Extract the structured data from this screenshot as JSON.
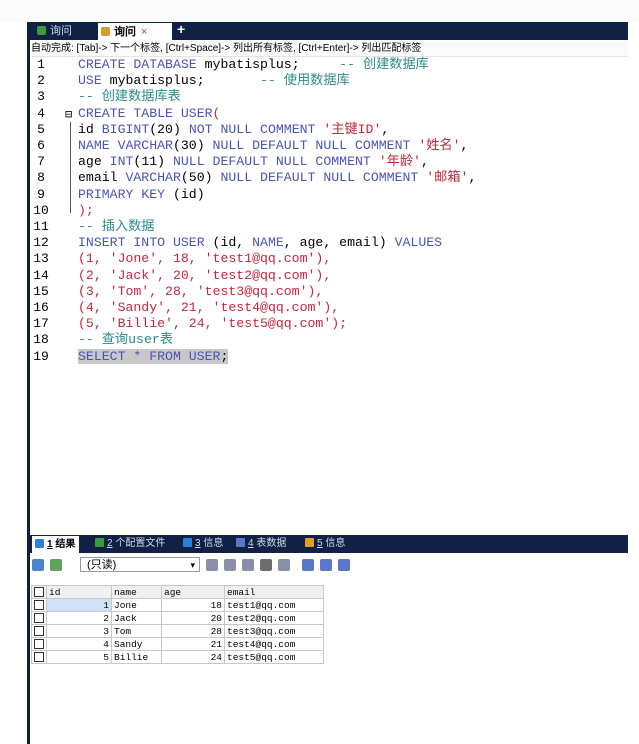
{
  "tabs": [
    {
      "label": "询问",
      "active": false
    },
    {
      "label": "询问",
      "active": true
    }
  ],
  "new_tab": "+",
  "close_mark": "×",
  "hint": "自动完成: [Tab]-> 下一个标签, [Ctrl+Space]-> 列出所有标签, [Ctrl+Enter]-> 列出匹配标签",
  "editor": {
    "line_numbers": [
      "1",
      "2",
      "3",
      "4",
      "5",
      "6",
      "7",
      "8",
      "9",
      "10",
      "11",
      "12",
      "13",
      "14",
      "15",
      "16",
      "17",
      "18",
      "19"
    ],
    "fold_mark": "⊟",
    "lines": [
      [
        {
          "t": "CREATE DATABASE ",
          "c": "kw"
        },
        {
          "t": "mybatisplus",
          "c": "id"
        },
        {
          "t": ";     ",
          "c": "id"
        },
        {
          "t": "-- 创建数据库",
          "c": "cm"
        }
      ],
      [
        {
          "t": "USE ",
          "c": "kw"
        },
        {
          "t": "mybatisplus",
          "c": "id"
        },
        {
          "t": ";       ",
          "c": "id"
        },
        {
          "t": "-- 使用数据库",
          "c": "cm"
        }
      ],
      [
        {
          "t": "-- 创建数据库表",
          "c": "cm"
        }
      ],
      [
        {
          "t": "CREATE TABLE ",
          "c": "kw"
        },
        {
          "t": "USER",
          "c": "kw"
        },
        {
          "t": "(",
          "c": "str"
        }
      ],
      [
        {
          "t": "id ",
          "c": "id"
        },
        {
          "t": "BIGINT",
          "c": "kw"
        },
        {
          "t": "(20) ",
          "c": "id"
        },
        {
          "t": "NOT NULL COMMENT ",
          "c": "kw"
        },
        {
          "t": "'主键ID'",
          "c": "str"
        },
        {
          "t": ",",
          "c": "id"
        }
      ],
      [
        {
          "t": "NAME VARCHAR",
          "c": "kw"
        },
        {
          "t": "(30) ",
          "c": "id"
        },
        {
          "t": "NULL DEFAULT NULL COMMENT ",
          "c": "kw"
        },
        {
          "t": "'姓名'",
          "c": "str"
        },
        {
          "t": ",",
          "c": "id"
        }
      ],
      [
        {
          "t": "age ",
          "c": "id"
        },
        {
          "t": "INT",
          "c": "kw"
        },
        {
          "t": "(11) ",
          "c": "id"
        },
        {
          "t": "NULL DEFAULT NULL COMMENT ",
          "c": "kw"
        },
        {
          "t": "'年龄'",
          "c": "str"
        },
        {
          "t": ",",
          "c": "id"
        }
      ],
      [
        {
          "t": "email ",
          "c": "id"
        },
        {
          "t": "VARCHAR",
          "c": "kw"
        },
        {
          "t": "(50) ",
          "c": "id"
        },
        {
          "t": "NULL DEFAULT NULL COMMENT ",
          "c": "kw"
        },
        {
          "t": "'邮箱'",
          "c": "str"
        },
        {
          "t": ",",
          "c": "id"
        }
      ],
      [
        {
          "t": "PRIMARY KEY ",
          "c": "kw"
        },
        {
          "t": "(id)",
          "c": "id"
        }
      ],
      [
        {
          "t": ");",
          "c": "str"
        }
      ],
      [
        {
          "t": "-- 插入数据",
          "c": "cm"
        }
      ],
      [
        {
          "t": "INSERT INTO ",
          "c": "kw"
        },
        {
          "t": "USER ",
          "c": "kw"
        },
        {
          "t": "(id, ",
          "c": "id"
        },
        {
          "t": "NAME",
          "c": "kw"
        },
        {
          "t": ", age, email) ",
          "c": "id"
        },
        {
          "t": "VALUES",
          "c": "kw"
        }
      ],
      [
        {
          "t": "(1, ",
          "c": "str"
        },
        {
          "t": "'Jone'",
          "c": "str"
        },
        {
          "t": ", 18, ",
          "c": "str"
        },
        {
          "t": "'test1@qq.com'",
          "c": "str"
        },
        {
          "t": "),",
          "c": "str"
        }
      ],
      [
        {
          "t": "(2, ",
          "c": "str"
        },
        {
          "t": "'Jack'",
          "c": "str"
        },
        {
          "t": ", 20, ",
          "c": "str"
        },
        {
          "t": "'test2@qq.com'",
          "c": "str"
        },
        {
          "t": "),",
          "c": "str"
        }
      ],
      [
        {
          "t": "(3, ",
          "c": "str"
        },
        {
          "t": "'Tom'",
          "c": "str"
        },
        {
          "t": ", 28, ",
          "c": "str"
        },
        {
          "t": "'test3@qq.com'",
          "c": "str"
        },
        {
          "t": "),",
          "c": "str"
        }
      ],
      [
        {
          "t": "(4, ",
          "c": "str"
        },
        {
          "t": "'Sandy'",
          "c": "str"
        },
        {
          "t": ", 21, ",
          "c": "str"
        },
        {
          "t": "'test4@qq.com'",
          "c": "str"
        },
        {
          "t": "),",
          "c": "str"
        }
      ],
      [
        {
          "t": "(5, ",
          "c": "str"
        },
        {
          "t": "'Billie'",
          "c": "str"
        },
        {
          "t": ", 24, ",
          "c": "str"
        },
        {
          "t": "'test5@qq.com'",
          "c": "str"
        },
        {
          "t": ");",
          "c": "str"
        }
      ],
      [
        {
          "t": "-- 查询user表",
          "c": "cm"
        }
      ],
      [
        {
          "t": "SELECT * FROM USER",
          "c": "kw sel"
        },
        {
          "t": ";",
          "c": "id sel"
        }
      ]
    ]
  },
  "result_tabs": [
    {
      "num": "1",
      "label": "结果",
      "icon_color": "#2f7fd8",
      "active": true
    },
    {
      "num": "2",
      "label": "个配置文件",
      "icon_color": "#3e9a3e",
      "active": false
    },
    {
      "num": "3",
      "label": "信息",
      "icon_color": "#2f7fd8",
      "active": false
    },
    {
      "num": "4",
      "label": "表数据",
      "icon_color": "#5a77c8",
      "active": false
    },
    {
      "num": "5",
      "label": "信息",
      "icon_color": "#e0a020",
      "active": false
    }
  ],
  "toolbar": {
    "readonly_label": "(只读)",
    "dropdown_glyph": "▾"
  },
  "table": {
    "columns": [
      "id",
      "name",
      "age",
      "email"
    ],
    "rows": [
      [
        "1",
        "Jone",
        "18",
        "test1@qq.com"
      ],
      [
        "2",
        "Jack",
        "20",
        "test2@qq.com"
      ],
      [
        "3",
        "Tom",
        "28",
        "test3@qq.com"
      ],
      [
        "4",
        "Sandy",
        "21",
        "test4@qq.com"
      ],
      [
        "5",
        "Billie",
        "24",
        "test5@qq.com"
      ]
    ]
  },
  "colors": {
    "tab_bar": "#0f2245",
    "keyword": "#4b53b6",
    "string": "#c2273f",
    "comment": "#2e8b8b"
  }
}
